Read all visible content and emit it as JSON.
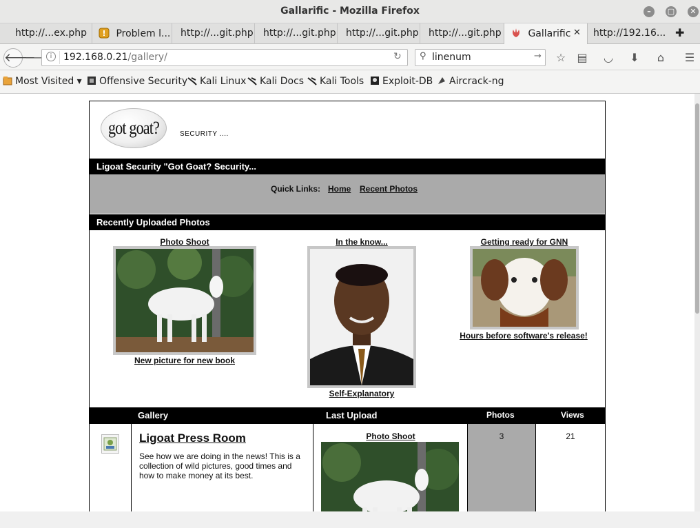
{
  "window": {
    "title": "Gallarific - Mozilla Firefox"
  },
  "tabs": [
    {
      "label": "http://...ex.php"
    },
    {
      "label": "Problem l..."
    },
    {
      "label": "http://...git.php"
    },
    {
      "label": "http://...git.php"
    },
    {
      "label": "http://...git.php"
    },
    {
      "label": "http://...git.php"
    },
    {
      "label": "Gallarific",
      "active": true
    },
    {
      "label": "http://192.16..."
    }
  ],
  "navbar": {
    "url_host": "192.168.0.21",
    "url_path": "/gallery/",
    "search_value": "linenum"
  },
  "bookmarks": [
    {
      "label": "Most Visited ▾"
    },
    {
      "label": "Offensive Security"
    },
    {
      "label": "Kali Linux"
    },
    {
      "label": "Kali Docs"
    },
    {
      "label": "Kali Tools"
    },
    {
      "label": "Exploit-DB"
    },
    {
      "label": "Aircrack-ng"
    }
  ],
  "site": {
    "logo_text": "got goat?",
    "tagline": "SECURITY ....",
    "banner": "Ligoat Security \"Got Goat? Security...",
    "quick_links_label": "Quick Links:",
    "quick_links": [
      "Home",
      "Recent Photos"
    ],
    "recent_heading": "Recently Uploaded Photos",
    "recent": [
      {
        "title": "Photo Shoot",
        "caption": "New picture for new book"
      },
      {
        "title": "In the know...",
        "caption": "Self-Explanatory"
      },
      {
        "title": "Getting ready for GNN",
        "caption": "Hours before software's release!"
      }
    ],
    "gallery_headers": {
      "gallery": "Gallery",
      "last_upload": "Last Upload",
      "photos": "Photos",
      "views": "Views"
    },
    "gallery_row": {
      "name": "Ligoat Press Room",
      "description": "See how we are doing in the news! This is a collection of wild pictures, good times and how to make money at its best.",
      "last_upload_title": "Photo Shoot",
      "photos": "3",
      "views": "21"
    }
  },
  "colors": {
    "accent_tab_icon": "#d9534f",
    "header_bar": "#000000",
    "quick_links_bg": "#aaaaaa"
  }
}
